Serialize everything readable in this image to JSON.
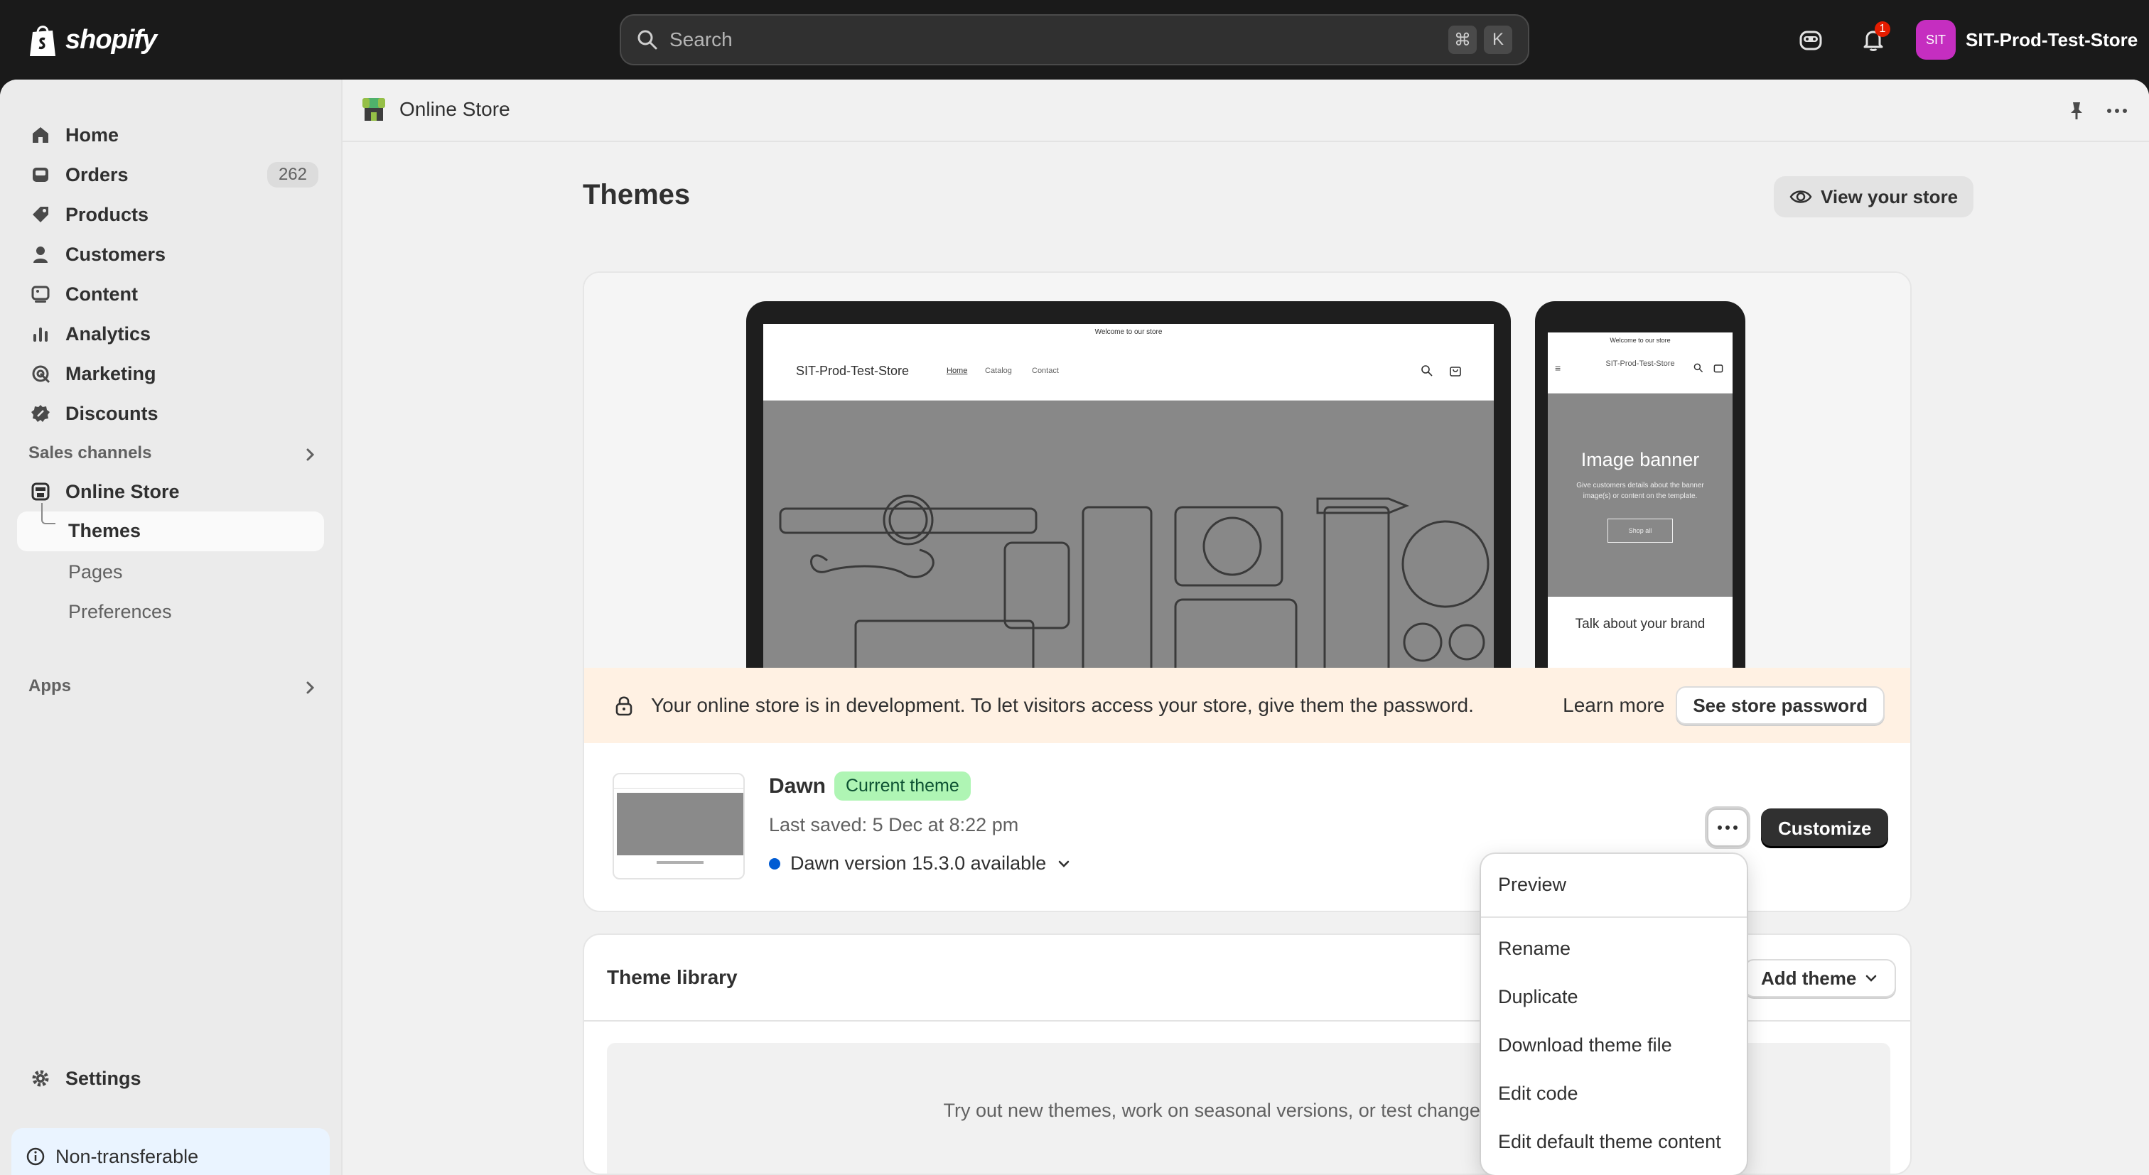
{
  "topbar": {
    "logo_text": "shopify",
    "search_placeholder": "Search",
    "search_shortcut_1": "⌘",
    "search_shortcut_2": "K",
    "notification_count": "1",
    "store_avatar": "SIT",
    "store_name": "SIT-Prod-Test-Store"
  },
  "sidebar": {
    "items": [
      {
        "label": "Home",
        "icon": "home-icon"
      },
      {
        "label": "Orders",
        "icon": "inbox-icon",
        "count": "262"
      },
      {
        "label": "Products",
        "icon": "tag-icon"
      },
      {
        "label": "Customers",
        "icon": "person-icon"
      },
      {
        "label": "Content",
        "icon": "image-icon"
      },
      {
        "label": "Analytics",
        "icon": "bar-chart-icon"
      },
      {
        "label": "Marketing",
        "icon": "target-icon"
      },
      {
        "label": "Discounts",
        "icon": "discount-icon"
      }
    ],
    "sales_channels_label": "Sales channels",
    "online_store_label": "Online Store",
    "themes_label": "Themes",
    "pages_label": "Pages",
    "preferences_label": "Preferences",
    "apps_label": "Apps",
    "settings_label": "Settings",
    "non_transferable_label": "Non-transferable"
  },
  "page_header": {
    "title": "Online Store"
  },
  "page": {
    "title": "Themes",
    "view_store_label": "View your store"
  },
  "preview": {
    "laptop_announcement": "Welcome to our store",
    "laptop_store_name": "SIT-Prod-Test-Store",
    "laptop_nav": [
      "Home",
      "Catalog",
      "Contact"
    ],
    "phone_announcement": "Welcome to our store",
    "phone_store_name": "SIT-Prod-Test-Store",
    "phone_banner_title": "Image banner",
    "phone_banner_sub": "Give customers details about the banner image(s) or content on the template.",
    "phone_banner_btn": "Shop all",
    "phone_talk": "Talk about your brand"
  },
  "dev_banner": {
    "text": "Your online store is in development. To let visitors access your store, give them the password.",
    "learn_more": "Learn more",
    "button": "See store password"
  },
  "current_theme": {
    "name": "Dawn",
    "badge": "Current theme",
    "last_saved": "Last saved: 5 Dec at 8:22 pm",
    "version": "Dawn version 15.3.0 available",
    "customize_label": "Customize"
  },
  "theme_menu": {
    "items": [
      "Preview",
      "Rename",
      "Duplicate",
      "Download theme file",
      "Edit code",
      "Edit default theme content"
    ]
  },
  "library": {
    "title": "Theme library",
    "add_theme_label": "Add theme",
    "empty_text": "Try out new themes, work on seasonal versions, or test changes to your"
  },
  "colors": {
    "topbar": "#1a1a1a",
    "badge_green": "#aff5b4",
    "dev_banner_bg": "#fff1e3",
    "avatar": "#c52ec0",
    "primary_button": "#303030",
    "version_dot": "#005bd3"
  }
}
